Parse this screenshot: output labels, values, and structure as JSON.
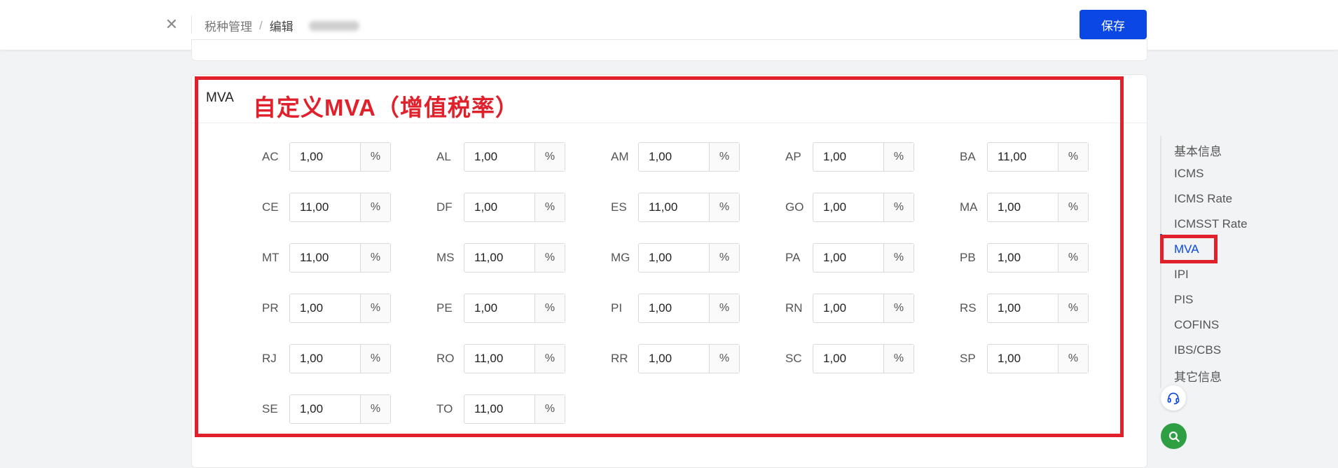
{
  "header": {
    "close_icon": "close-icon",
    "breadcrumb": [
      "税种管理",
      "编辑"
    ],
    "breadcrumb_separator": "/",
    "save_label": "保存"
  },
  "card": {
    "title": "MVA",
    "annotation": "自定义MVA（增值税率）",
    "unit": "%",
    "fields": [
      {
        "code": "AC",
        "value": "1,00"
      },
      {
        "code": "AL",
        "value": "1,00"
      },
      {
        "code": "AM",
        "value": "1,00"
      },
      {
        "code": "AP",
        "value": "1,00"
      },
      {
        "code": "BA",
        "value": "11,00"
      },
      {
        "code": "CE",
        "value": "11,00"
      },
      {
        "code": "DF",
        "value": "1,00"
      },
      {
        "code": "ES",
        "value": "11,00"
      },
      {
        "code": "GO",
        "value": "1,00"
      },
      {
        "code": "MA",
        "value": "1,00"
      },
      {
        "code": "MT",
        "value": "11,00"
      },
      {
        "code": "MS",
        "value": "11,00"
      },
      {
        "code": "MG",
        "value": "1,00"
      },
      {
        "code": "PA",
        "value": "1,00"
      },
      {
        "code": "PB",
        "value": "1,00"
      },
      {
        "code": "PR",
        "value": "1,00"
      },
      {
        "code": "PE",
        "value": "1,00"
      },
      {
        "code": "PI",
        "value": "1,00"
      },
      {
        "code": "RN",
        "value": "1,00"
      },
      {
        "code": "RS",
        "value": "1,00"
      },
      {
        "code": "RJ",
        "value": "1,00"
      },
      {
        "code": "RO",
        "value": "11,00"
      },
      {
        "code": "RR",
        "value": "1,00"
      },
      {
        "code": "SC",
        "value": "1,00"
      },
      {
        "code": "SP",
        "value": "1,00"
      },
      {
        "code": "SE",
        "value": "1,00"
      },
      {
        "code": "TO",
        "value": "11,00"
      }
    ]
  },
  "side_nav": {
    "items": [
      "基本信息",
      "ICMS",
      "ICMS Rate",
      "ICMSST Rate",
      "MVA",
      "IPI",
      "PIS",
      "COFINS",
      "IBS/CBS",
      "其它信息"
    ],
    "active": "MVA"
  },
  "floating_buttons": [
    {
      "icon": "headset-icon"
    },
    {
      "icon": "search-icon"
    }
  ],
  "colors": {
    "primary": "#0a47e5",
    "annotation_red": "#e0202b",
    "fab_green": "#2ea043"
  }
}
